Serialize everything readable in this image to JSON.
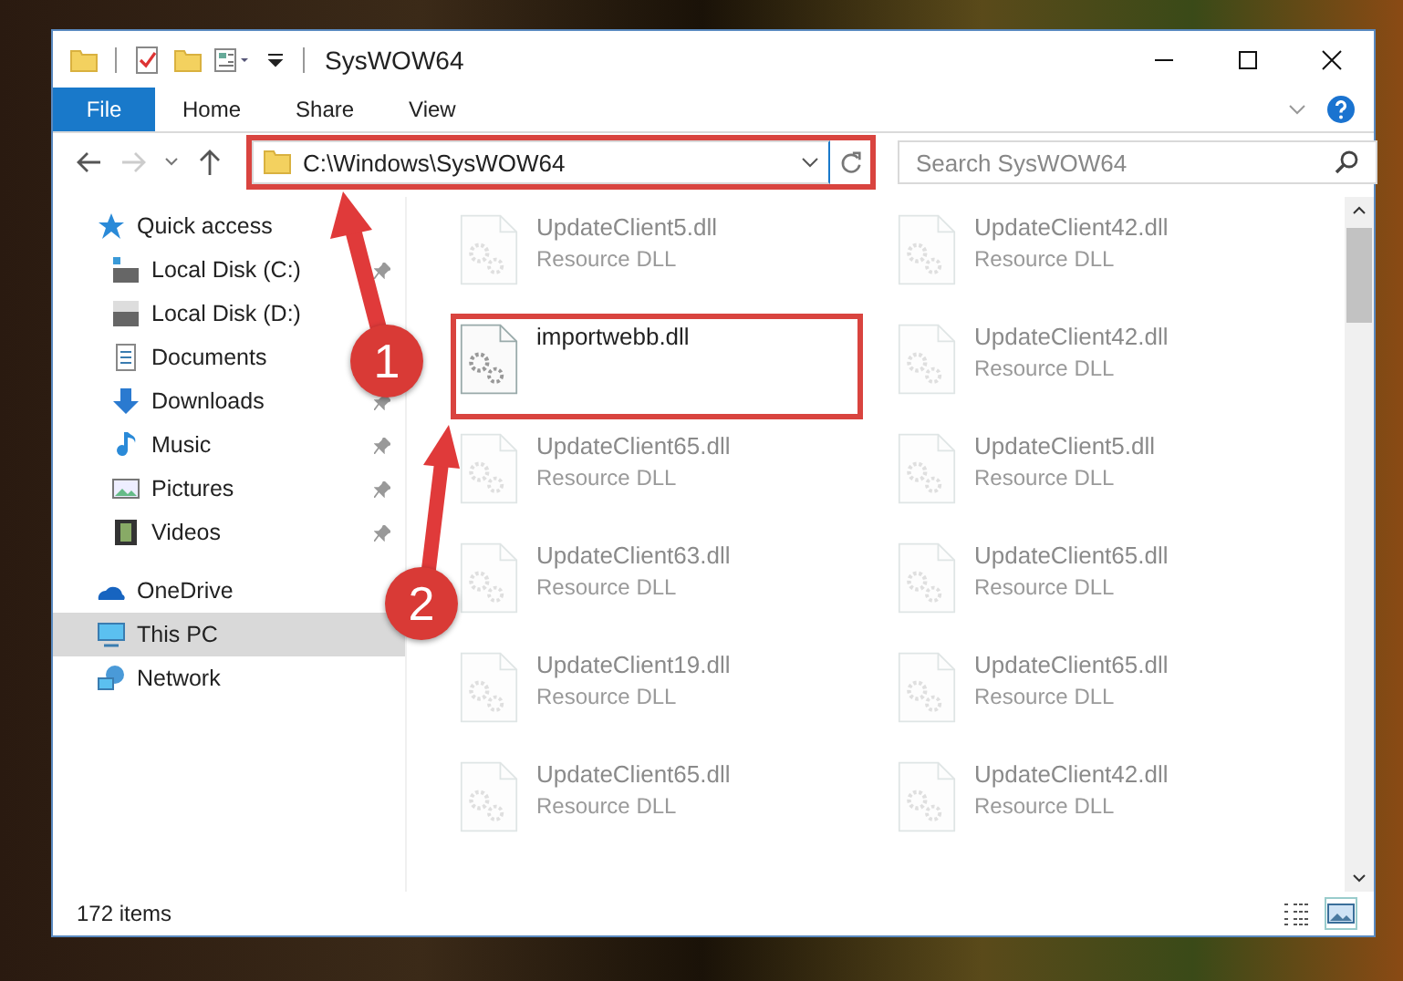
{
  "window": {
    "title": "SysWOW64"
  },
  "ribbon": {
    "tabs": [
      {
        "label": "File",
        "kind": "file",
        "selected": false
      },
      {
        "label": "Home",
        "kind": "tab",
        "selected": false
      },
      {
        "label": "Share",
        "kind": "tab",
        "selected": false
      },
      {
        "label": "View",
        "kind": "tab",
        "selected": false
      }
    ]
  },
  "address_bar": {
    "path": "C:\\Windows\\SysWOW64",
    "highlighted": true
  },
  "search": {
    "placeholder": "Search SysWOW64"
  },
  "navigation": [
    {
      "label": "Quick access",
      "kind": "star",
      "selected": false,
      "children": [
        {
          "label": "Local Disk (C:)",
          "kind": "drive-c",
          "pinned": true
        },
        {
          "label": "Local Disk (D:)",
          "kind": "drive",
          "pinned": false
        },
        {
          "label": "Documents",
          "kind": "documents",
          "pinned": false
        },
        {
          "label": "Downloads",
          "kind": "downloads",
          "pinned": true
        },
        {
          "label": "Music",
          "kind": "music",
          "pinned": true
        },
        {
          "label": "Pictures",
          "kind": "pictures",
          "pinned": true
        },
        {
          "label": "Videos",
          "kind": "videos",
          "pinned": true
        }
      ]
    },
    {
      "label": "OneDrive",
      "kind": "cloud",
      "selected": false
    },
    {
      "label": "This PC",
      "kind": "pc",
      "selected": true
    },
    {
      "label": "Network",
      "kind": "network",
      "selected": false
    }
  ],
  "files": [
    {
      "name": "UpdateClient5.dll",
      "type": "Resource DLL",
      "highlighted": false
    },
    {
      "name": "UpdateClient42.dll",
      "type": "Resource DLL",
      "highlighted": false
    },
    {
      "name": "importwebb.dll",
      "highlighted": true
    },
    {
      "name": "UpdateClient42.dll",
      "type": "Resource DLL",
      "highlighted": false
    },
    {
      "name": "UpdateClient65.dll",
      "type": "Resource DLL",
      "highlighted": false
    },
    {
      "name": "UpdateClient5.dll",
      "type": "Resource DLL",
      "highlighted": false
    },
    {
      "name": "UpdateClient63.dll",
      "type": "Resource DLL",
      "highlighted": false
    },
    {
      "name": "UpdateClient65.dll",
      "type": "Resource DLL",
      "highlighted": false
    },
    {
      "name": "UpdateClient19.dll",
      "type": "Resource DLL",
      "highlighted": false
    },
    {
      "name": "UpdateClient65.dll",
      "type": "Resource DLL",
      "highlighted": false
    },
    {
      "name": "UpdateClient65.dll",
      "type": "Resource DLL",
      "highlighted": false
    },
    {
      "name": "UpdateClient42.dll",
      "type": "Resource DLL",
      "highlighted": false
    }
  ],
  "status_bar": {
    "item_count": "172 items"
  },
  "callouts": [
    {
      "number": "1"
    },
    {
      "number": "2"
    }
  ]
}
